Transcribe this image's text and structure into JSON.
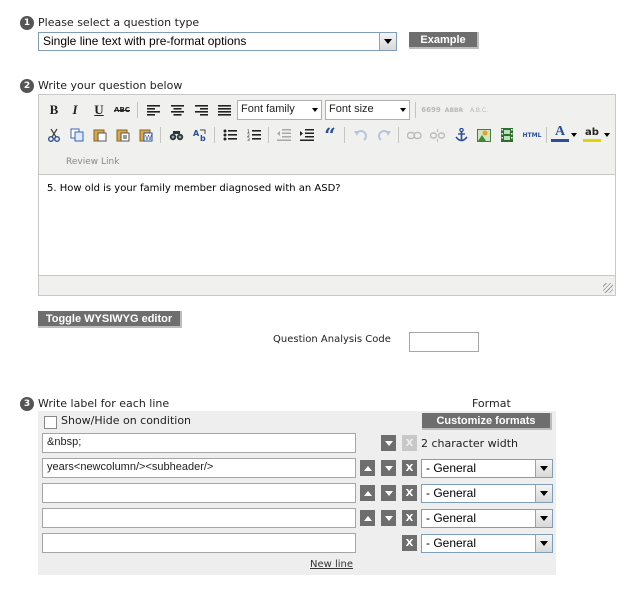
{
  "step1": {
    "number": "1",
    "label": "Please select a question type",
    "selected_type": "Single line text with pre-format options",
    "example_button": "Example"
  },
  "step2": {
    "number": "2",
    "label": "Write your question below",
    "toolbar": {
      "font_family": "Font family",
      "font_size": "Font size",
      "review_link": "Review Link",
      "icons_row1": [
        "bold-icon",
        "italic-icon",
        "underline-icon",
        "strikethrough-icon",
        "align-left-icon",
        "align-center-icon",
        "align-right-icon",
        "align-justify-icon",
        "quote-marks-icon",
        "abbr-icon",
        "acronym-icon"
      ],
      "icons_row2": [
        "cut-icon",
        "copy-icon",
        "paste-icon",
        "paste-text-icon",
        "paste-word-icon",
        "find-icon",
        "replace-icon",
        "bullet-list-icon",
        "numbered-list-icon",
        "outdent-icon",
        "indent-icon",
        "blockquote-icon",
        "undo-icon",
        "redo-icon",
        "link-icon",
        "unlink-icon",
        "anchor-icon",
        "image-icon",
        "media-icon",
        "html-icon",
        "text-color-icon",
        "highlight-icon"
      ],
      "glyphs": {
        "bold": "B",
        "italic": "I",
        "underline": "U",
        "strike": "ABC",
        "abbr": "ABBR",
        "acronym": "A.B.C.",
        "quote": "6699",
        "html": "HTML",
        "blockquote": "“",
        "textcolor": "A",
        "highlight": "ab"
      }
    },
    "question_text": "5. How old is your family member diagnosed with an ASD?",
    "toggle_button": "Toggle WYSIWYG editor",
    "analysis_code_label": "Question Analysis Code",
    "analysis_code_value": ""
  },
  "step3": {
    "number": "3",
    "label": "Write label for each line",
    "format_header": "Format",
    "show_hide_label": "Show/Hide on condition",
    "customize_button": "Customize formats",
    "delete_glyph": "X",
    "rows": [
      {
        "value": "&nbsp;",
        "format": "2 character width"
      },
      {
        "value": "years<newcolumn/><subheader/>",
        "format": "- General"
      },
      {
        "value": "",
        "format": "- General"
      },
      {
        "value": "",
        "format": "- General"
      },
      {
        "value": "",
        "format": "- General"
      }
    ],
    "new_line_link": "New line"
  },
  "colors": {
    "dark_button": "#6e6e6e",
    "toolbar_bg": "#f0f0ee",
    "panel_bg": "#eeeeee",
    "select_border": "#7f9db9"
  }
}
